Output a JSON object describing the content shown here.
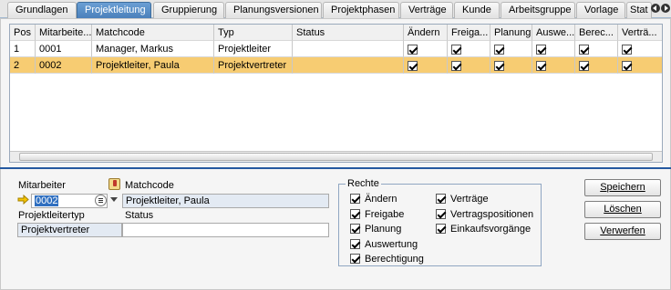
{
  "tabs": [
    "Grundlagen",
    "Projektleitung",
    "Gruppierung",
    "Planungsversionen",
    "Projektphasen",
    "Verträge",
    "Kunde",
    "Arbeitsgruppe",
    "Vorlage",
    "Stat"
  ],
  "active_tab": "Projektleitung",
  "table": {
    "columns": [
      "Pos",
      "Mitarbeite...",
      "Matchcode",
      "Typ",
      "Status",
      "Ändern",
      "Freiga...",
      "Planung",
      "Auswe...",
      "Berec...",
      "Verträ..."
    ],
    "rows": [
      {
        "pos": "1",
        "mitarbeiter": "0001",
        "matchcode": "Manager, Markus",
        "typ": "Projektleiter",
        "status": "",
        "checks": [
          true,
          true,
          true,
          true,
          true,
          true
        ],
        "selected": false
      },
      {
        "pos": "2",
        "mitarbeiter": "0002",
        "matchcode": "Projektleiter, Paula",
        "typ": "Projektvertreter",
        "status": "",
        "checks": [
          true,
          true,
          true,
          true,
          true,
          true
        ],
        "selected": true
      }
    ]
  },
  "form": {
    "mitarbeiter_label": "Mitarbeiter",
    "mitarbeiter_value": "0002",
    "matchcode_label": "Matchcode",
    "matchcode_value": "Projektleiter, Paula",
    "projektleitertyp_label": "Projektleitertyp",
    "projektleitertyp_value": "Projektvertreter",
    "status_label": "Status",
    "status_value": ""
  },
  "rechte": {
    "title": "Rechte",
    "left": [
      {
        "label": "Ändern",
        "checked": true
      },
      {
        "label": "Freigabe",
        "checked": true
      },
      {
        "label": "Planung",
        "checked": true
      },
      {
        "label": "Auswertung",
        "checked": true
      },
      {
        "label": "Berechtigung",
        "checked": true
      }
    ],
    "right": [
      {
        "label": "Verträge",
        "checked": true
      },
      {
        "label": "Vertragspositionen",
        "checked": true
      },
      {
        "label": "Einkaufsvorgänge",
        "checked": true
      }
    ]
  },
  "buttons": {
    "save": "Speichern",
    "delete": "Löschen",
    "discard": "Verwerfen"
  },
  "colors": {
    "active_tab": "#5a8fc8",
    "selected_row": "#f7cc72",
    "separator": "#2559a0"
  }
}
